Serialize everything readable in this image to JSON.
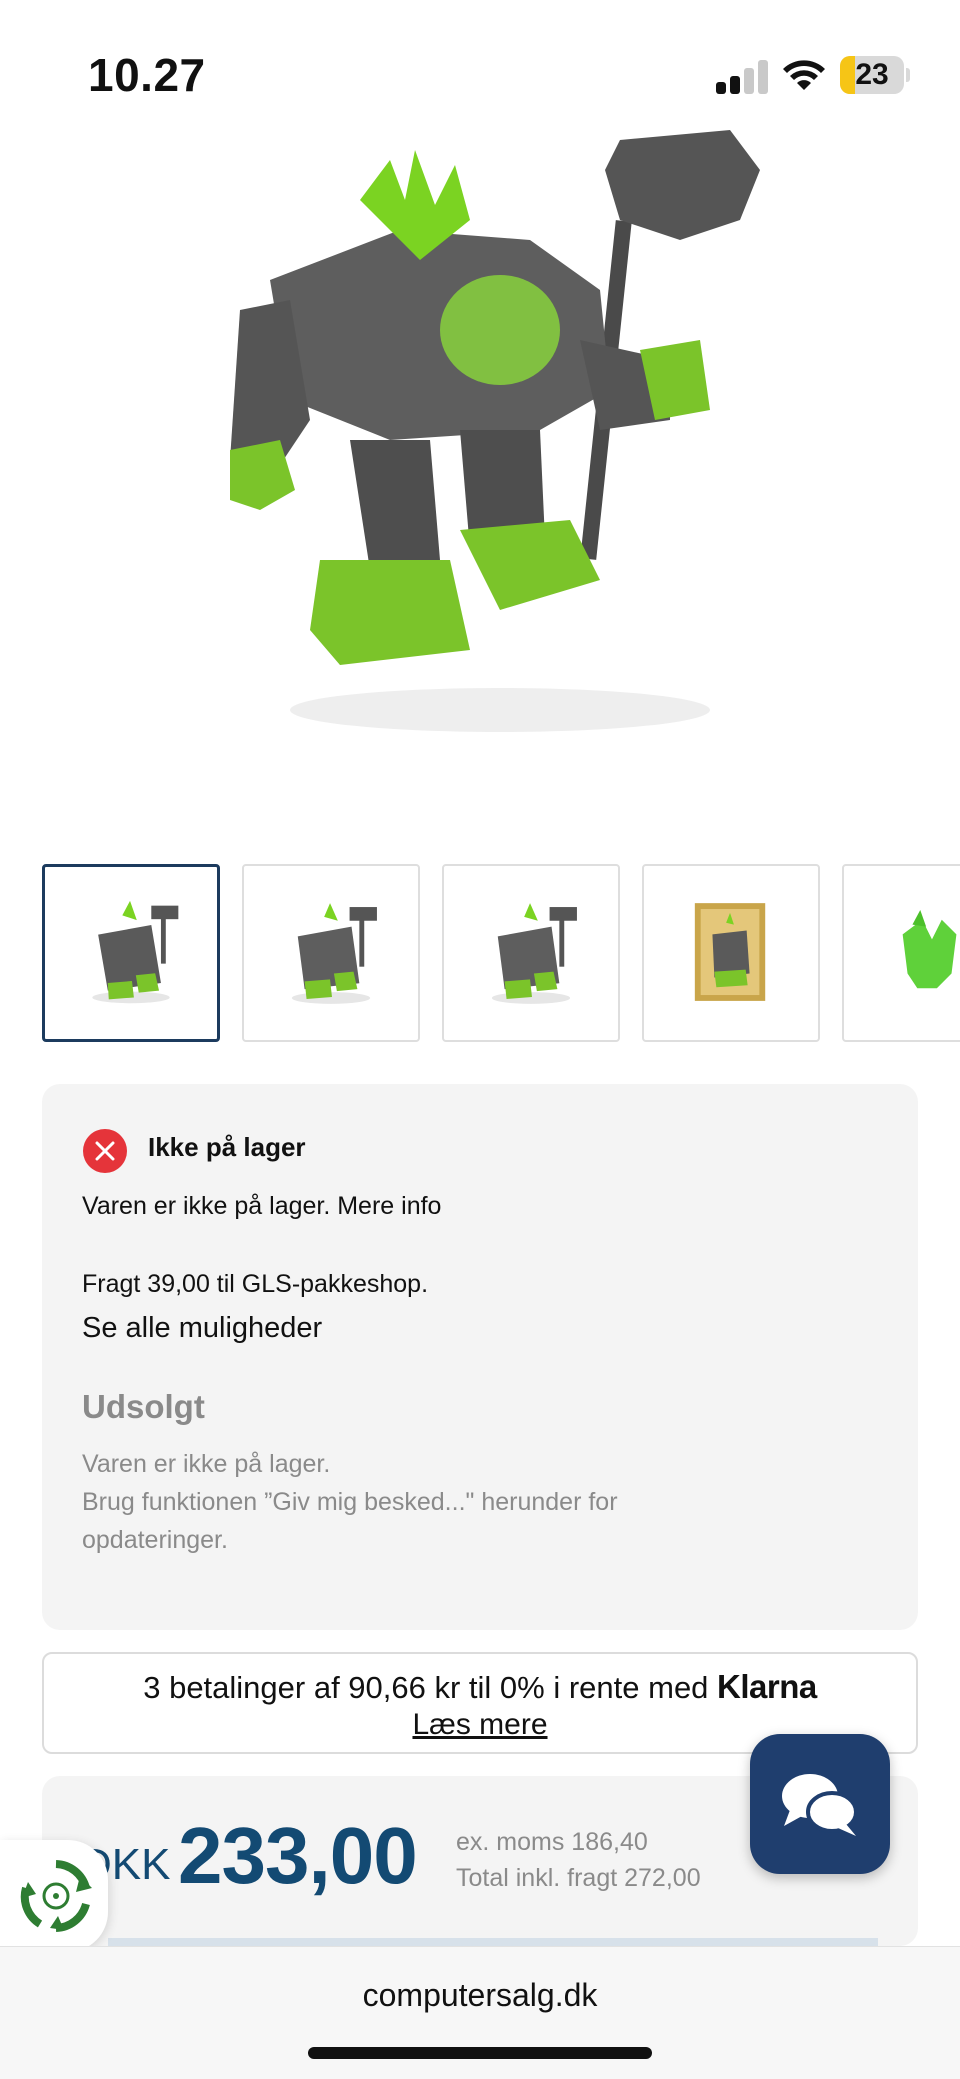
{
  "status_bar": {
    "time": "10.27",
    "battery_level": "23",
    "battery_fraction": 0.23,
    "signal_bars_active": 2,
    "signal_bars_total": 4,
    "battery_color": "#f6c516"
  },
  "product": {
    "main_image_icon": "rock-robot-figure",
    "thumbnails": [
      {
        "icon": "rock-robot-thumbnail",
        "selected": true
      },
      {
        "icon": "rock-robot-thumbnail",
        "selected": false
      },
      {
        "icon": "rock-robot-thumbnail",
        "selected": false
      },
      {
        "icon": "boxed-figure-thumbnail",
        "selected": false
      },
      {
        "icon": "green-creature-thumbnail",
        "selected": false
      }
    ]
  },
  "stock": {
    "status_icon": "close-circle-icon",
    "status_color": "#e5343a",
    "title": "Ikke på lager",
    "info_text": "Varen er ikke på lager. Mere info",
    "shipping_text": "Fragt 39,00 til GLS-pakkeshop.",
    "options_link": "Se alle muligheder",
    "soldout_title": "Udsolgt",
    "soldout_lines": [
      "Varen er ikke på lager.",
      "Brug funktionen ”Giv mig besked...\" herunder for",
      "opdateringer."
    ]
  },
  "klarna": {
    "text": "3 betalinger af 90,66 kr til 0% i rente med ",
    "brand": "Klarna",
    "link": "Læs mere"
  },
  "price": {
    "currency": "DKK",
    "amount": "233,00",
    "ex_vat": "ex. moms 186,40",
    "total": "Total inkl. fragt 272,00",
    "color": "#134a73"
  },
  "chat": {
    "icon": "chat-bubbles-icon",
    "color": "#1f3e6e"
  },
  "eco_badge": {
    "icon": "recycle-icon"
  },
  "browser": {
    "url": "computersalg.dk"
  }
}
